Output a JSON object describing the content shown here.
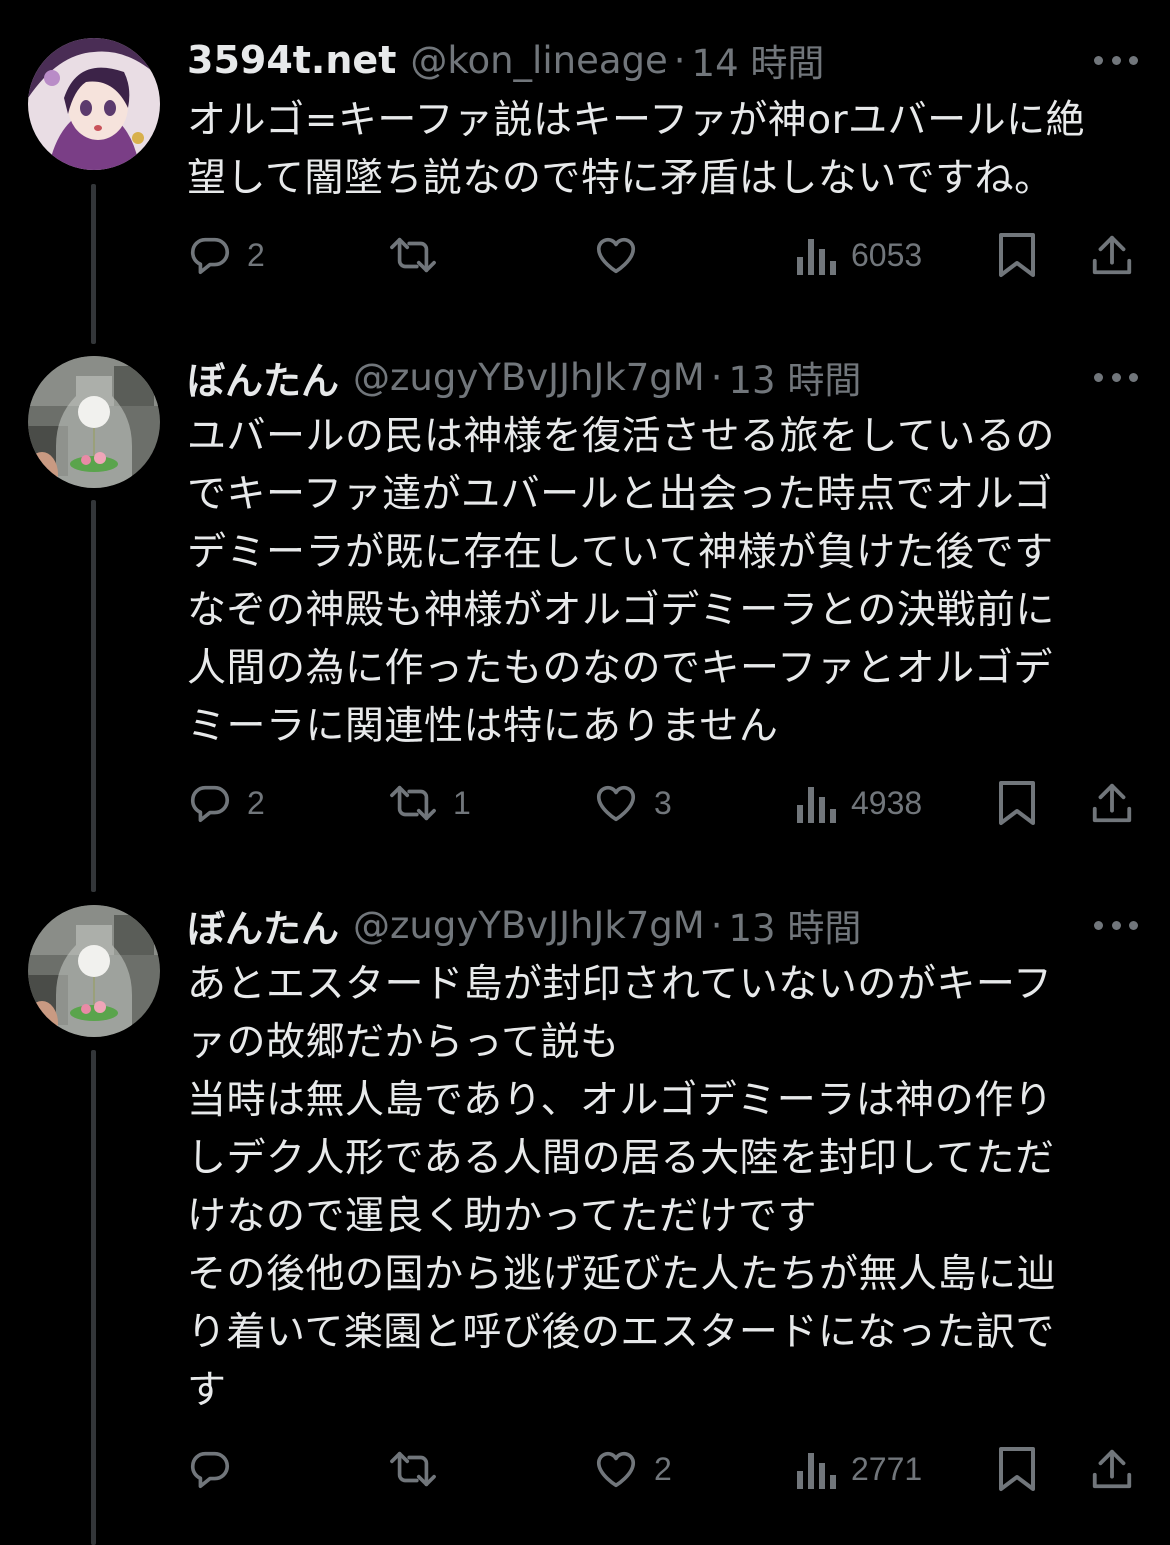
{
  "tweets": [
    {
      "name": "3594t.net",
      "handle": "@kon_lineage",
      "dot": "·",
      "time": "14 時間",
      "lines": [
        "オルゴ=キーファ説はキーファが神orユバールに絶",
        "望して闇墜ち説なので特に矛盾はしないですね。"
      ],
      "replies": "2",
      "retweets": "",
      "likes": "",
      "views": "6053"
    },
    {
      "name": "ぼんたん",
      "handle": "@zugyYBvJJhJk7gM",
      "dot": "·",
      "time": "13 時間",
      "lines": [
        "ユバールの民は神様を復活させる旅をしているの",
        "でキーファ達がユバールと出会った時点でオルゴ",
        "デミーラが既に存在していて神様が負けた後です",
        "なぞの神殿も神様がオルゴデミーラとの決戦前に",
        "人間の為に作ったものなのでキーファとオルゴデ",
        "ミーラに関連性は特にありません"
      ],
      "replies": "2",
      "retweets": "1",
      "likes": "3",
      "views": "4938"
    },
    {
      "name": "ぼんたん",
      "handle": "@zugyYBvJJhJk7gM",
      "dot": "·",
      "time": "13 時間",
      "lines": [
        "あとエスタード島が封印されていないのがキーフ",
        "ァの故郷だからって説も",
        "当時は無人島であり、オルゴデミーラは神の作り",
        "しデク人形である人間の居る大陸を封印してただ",
        "けなので運良く助かってただけです",
        "その後他の国から逃げ延びた人たちが無人島に辿",
        "り着いて楽園と呼び後のエスタードになった訳で",
        "す"
      ],
      "replies": "",
      "retweets": "",
      "likes": "2",
      "views": "2771"
    }
  ],
  "icons": {
    "reply": "reply-icon",
    "retweet": "retweet-icon",
    "like": "heart-icon",
    "views": "views-icon",
    "bookmark": "bookmark-icon",
    "share": "share-icon",
    "more": "more-icon"
  },
  "colors": {
    "background": "#000000",
    "text": "#e7e9ea",
    "secondary": "#71767b",
    "thread_line": "#333639"
  }
}
